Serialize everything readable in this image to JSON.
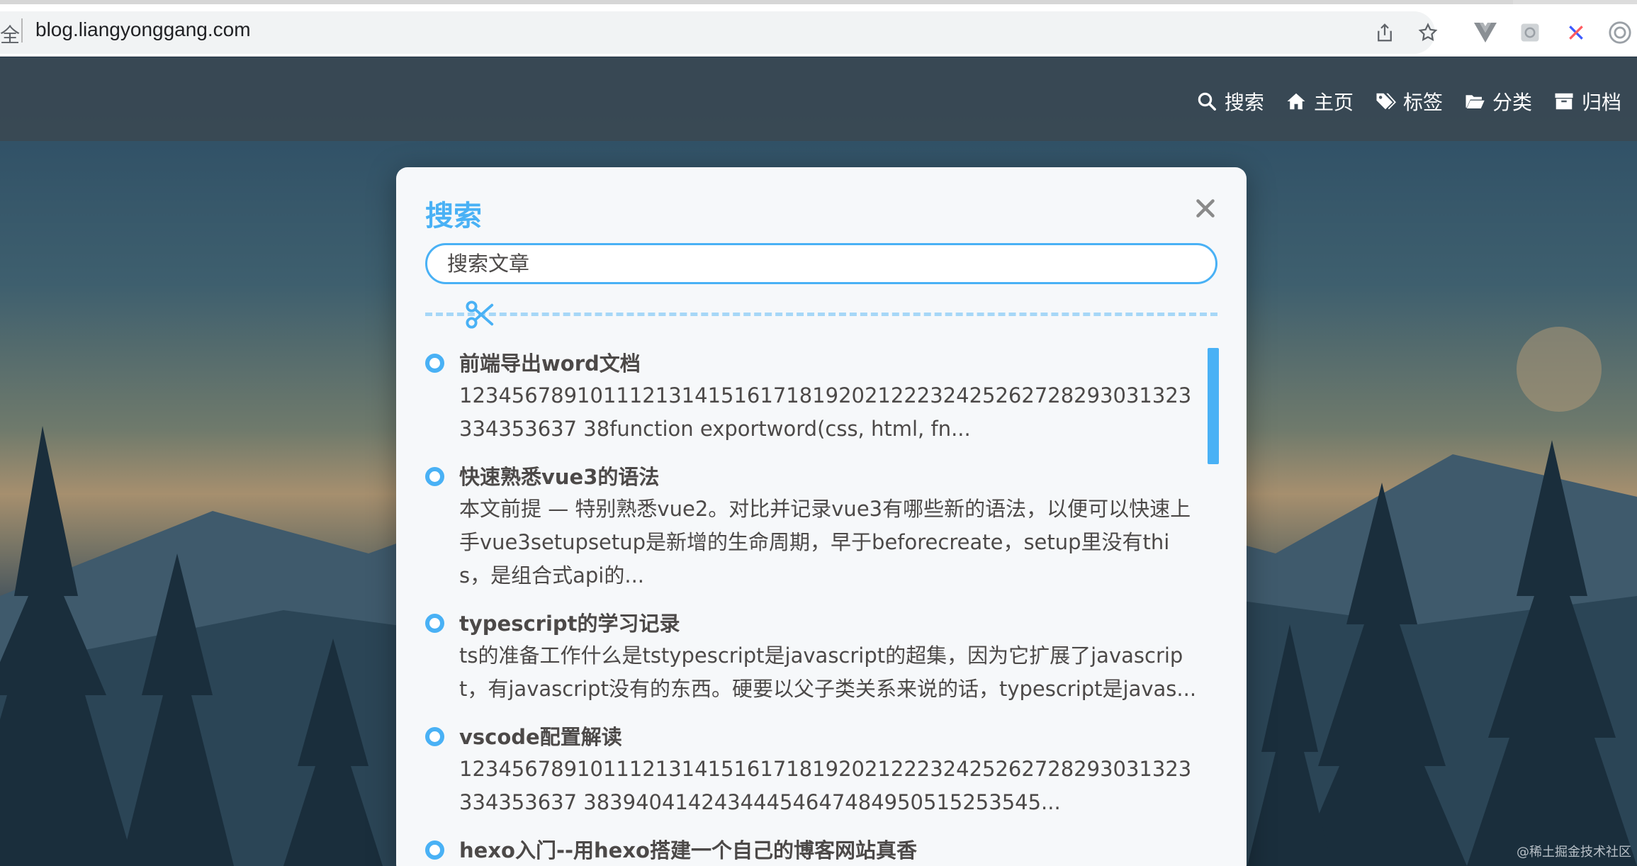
{
  "browser": {
    "secure_fragment": "全",
    "url": "blog.liangyonggang.com",
    "icons": [
      "share-icon",
      "star-icon",
      "vue-devtools-icon",
      "extension-icon",
      "x-extension-icon",
      "profile-icon"
    ]
  },
  "nav": {
    "items": [
      {
        "icon": "search-icon",
        "label": "搜索"
      },
      {
        "icon": "home-icon",
        "label": "主页"
      },
      {
        "icon": "tags-icon",
        "label": "标签"
      },
      {
        "icon": "folder-icon",
        "label": "分类"
      },
      {
        "icon": "archive-icon",
        "label": "归档"
      }
    ]
  },
  "search": {
    "title": "搜索",
    "placeholder": "搜索文章",
    "close_icon": "close-icon",
    "divider_icon": "scissors-icon"
  },
  "results": [
    {
      "title": "前端导出word文档",
      "excerpt": "12345678910111213141516171819202122232425262728293031323334353637 38function exportword(css, html, fn..."
    },
    {
      "title": "快速熟悉vue3的语法",
      "excerpt": "本文前提 — 特别熟悉vue2。对比并记录vue3有哪些新的语法，以便可以快速上手vue3setupsetup是新增的生命周期，早于beforecreate，setup里没有this，是组合式api的..."
    },
    {
      "title": "typescript的学习记录",
      "excerpt": "ts的准备工作什么是tstypescript是javascript的超集，因为它扩展了javascript，有javascript没有的东西。硬要以父子类关系来说的话，typescript是javas..."
    },
    {
      "title": "vscode配置解读",
      "excerpt": "12345678910111213141516171819202122232425262728293031323334353637 38394041424344454647484950515253545..."
    },
    {
      "title": "hexo入门--用hexo搭建一个自己的博客网站真香",
      "excerpt": ""
    }
  ],
  "watermark": "@稀土掘金技术社区",
  "colors": {
    "accent": "#49b1f5",
    "text": "#4c4948"
  }
}
